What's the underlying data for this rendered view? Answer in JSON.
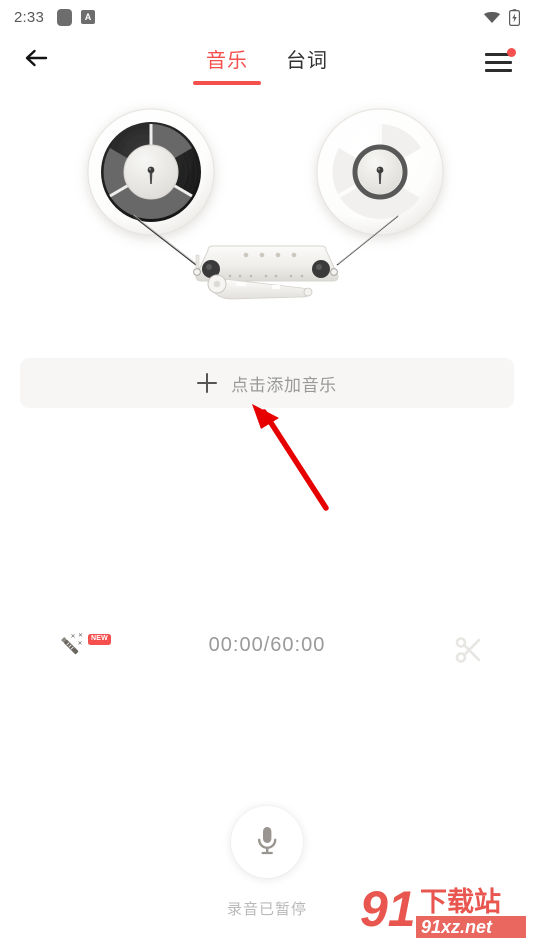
{
  "status_bar": {
    "time": "2:33",
    "icons": [
      "app-square-icon",
      "a-badge-icon",
      "wifi-icon",
      "battery-charging-icon"
    ],
    "a_badge_text": "A"
  },
  "appbar": {
    "back_icon": "back-arrow-icon",
    "menu_icon": "hamburger-menu-icon",
    "menu_has_notification": true,
    "tabs": [
      {
        "label": "音乐",
        "active": true
      },
      {
        "label": "台词",
        "active": false
      }
    ]
  },
  "illustration": {
    "name": "reel-to-reel-tape-deck",
    "left_reel": "full-tape-reel",
    "right_reel": "empty-tape-reel",
    "head_block": "tape-head-assembly"
  },
  "add_music": {
    "label": "点击添加音乐",
    "icon": "plus-icon"
  },
  "annotation": {
    "type": "red-arrow",
    "points_to": "add-music-button"
  },
  "toolbar": {
    "wand_icon": "magic-wand-icon",
    "new_badge": "NEW",
    "timecode": "00:00/60:00",
    "cut_icon": "scissors-icon"
  },
  "record": {
    "mic_icon": "microphone-icon",
    "status_label": "录音已暂停"
  },
  "watermark": {
    "title": "下载站",
    "number": "91",
    "domain": "91xz.net"
  },
  "colors": {
    "accent_red": "#f5504e",
    "tab_inactive": "#333333",
    "muted_text": "#999999",
    "panel_bg": "#f7f6f5",
    "page_bg": "#ffffff"
  }
}
